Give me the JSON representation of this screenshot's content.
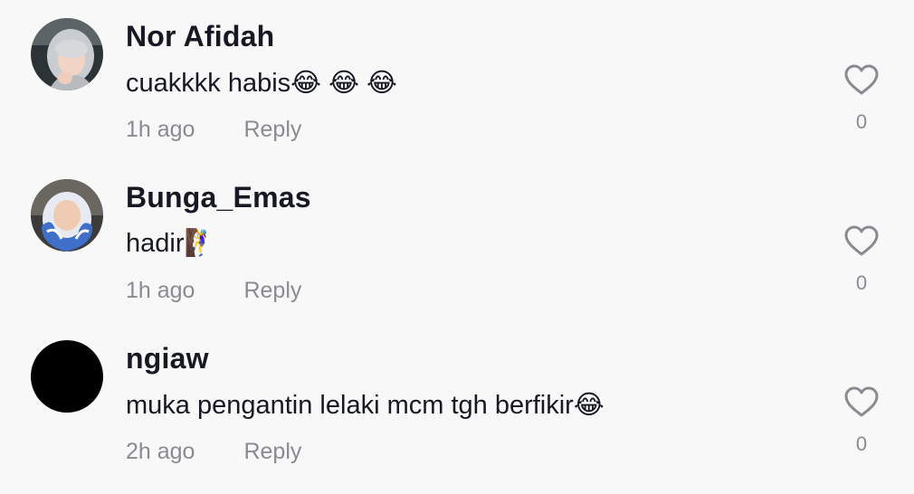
{
  "comments": [
    {
      "username": "Nor Afidah",
      "text": "cuakkkk habis😂 😂 😂",
      "time": "1h ago",
      "reply_label": "Reply",
      "likes": "0",
      "avatar_icon": "user-avatar-hijab-grey"
    },
    {
      "username": "Bunga_Emas",
      "text": "hadir🧗‍♀️",
      "time": "1h ago",
      "reply_label": "Reply",
      "likes": "0",
      "avatar_icon": "user-avatar-hijab-blue"
    },
    {
      "username": "ngiaw",
      "text": "muka pengantin lelaki mcm tgh berfikir😂",
      "time": "2h ago",
      "reply_label": "Reply",
      "likes": "0",
      "avatar_icon": "user-avatar-black"
    }
  ],
  "colors": {
    "background": "#f8f8f8",
    "username": "#161823",
    "secondary_text": "#8a8b91",
    "heart_outline": "#8a8b91"
  },
  "icons": {
    "like": "heart-outline-icon"
  }
}
